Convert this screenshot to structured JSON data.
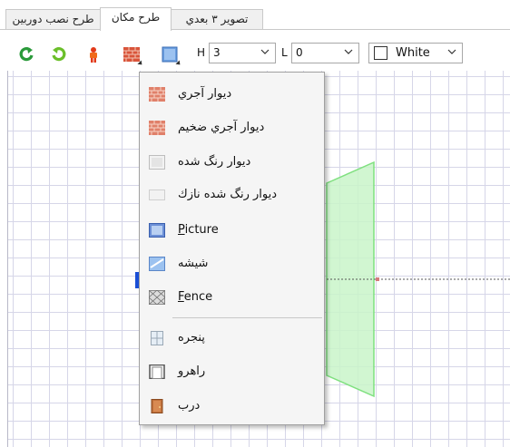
{
  "tabs": [
    {
      "label": "طرح نصب دوربين",
      "active": false
    },
    {
      "label": "طرح مكان",
      "active": true
    },
    {
      "label": "تصوير ۳ بعدي",
      "active": false
    }
  ],
  "toolbar": {
    "h_label": "H",
    "h_value": "3",
    "l_label": "L",
    "l_value": "0",
    "color_value": "White",
    "color_swatch": "#ffffff",
    "icons": [
      "undo-icon",
      "redo-icon",
      "person-icon",
      "brick-wall-icon",
      "box-icon"
    ]
  },
  "menu": {
    "items": [
      {
        "label": "ديوار آجري",
        "icon": "brick-wall-icon"
      },
      {
        "label": "ديوار آجري ضخيم",
        "icon": "thick-brick-wall-icon"
      },
      {
        "label": "ديوار رنگ شده",
        "icon": "painted-wall-icon"
      },
      {
        "label": "ديوار رنگ شده نازك",
        "icon": "thin-painted-wall-icon"
      },
      {
        "label": "Picture",
        "icon": "picture-icon"
      },
      {
        "label": "شيشه",
        "icon": "glass-icon"
      },
      {
        "label": "Fence",
        "icon": "fence-icon"
      },
      {
        "label": "پنجره",
        "icon": "window-icon"
      },
      {
        "label": "راهرو",
        "icon": "corridor-icon"
      },
      {
        "label": "درب",
        "icon": "door-icon"
      }
    ]
  },
  "colors": {
    "accent": "#1a4fd6",
    "shape_fill": "#c9f5c9",
    "shape_stroke": "#7fe07f",
    "grid": "#d6d6e8"
  }
}
